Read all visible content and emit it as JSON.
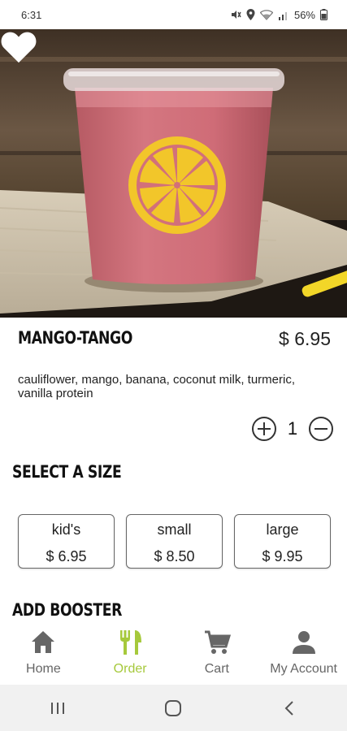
{
  "status_bar": {
    "time": "6:31",
    "battery": "56%",
    "icons": [
      "mute-icon",
      "location-icon",
      "wifi-icon",
      "signal-icon",
      "battery-icon"
    ]
  },
  "hero": {
    "image": "smoothie-cup-photo",
    "favorite_icon": "heart-icon"
  },
  "product": {
    "name": "MANGO-TANGO",
    "price": "$ 6.95",
    "description": "cauliflower, mango, banana, coconut milk, turmeric, vanilla protein"
  },
  "quantity": {
    "value": "1",
    "increase_icon": "plus-circle-icon",
    "decrease_icon": "minus-circle-icon"
  },
  "size_section": {
    "title": "SELECT A SIZE",
    "options": [
      {
        "name": "kid's",
        "price": "$ 6.95"
      },
      {
        "name": "small",
        "price": "$ 8.50"
      },
      {
        "name": "large",
        "price": "$ 9.95"
      }
    ]
  },
  "booster_section": {
    "title": "ADD BOOSTER"
  },
  "bottom_nav": {
    "items": [
      {
        "label": "Home",
        "icon": "home-icon"
      },
      {
        "label": "Order",
        "icon": "fork-knife-icon",
        "active": true
      },
      {
        "label": "Cart",
        "icon": "cart-icon"
      },
      {
        "label": "My Account",
        "icon": "person-icon"
      }
    ]
  },
  "system_nav": {
    "icons": [
      "recents-icon",
      "home-circle-icon",
      "back-icon"
    ]
  },
  "colors": {
    "accent": "#a6c93c",
    "text": "#222222",
    "muted": "#666666",
    "smoothie": "#c8636c",
    "logo_yellow": "#f3c928"
  }
}
